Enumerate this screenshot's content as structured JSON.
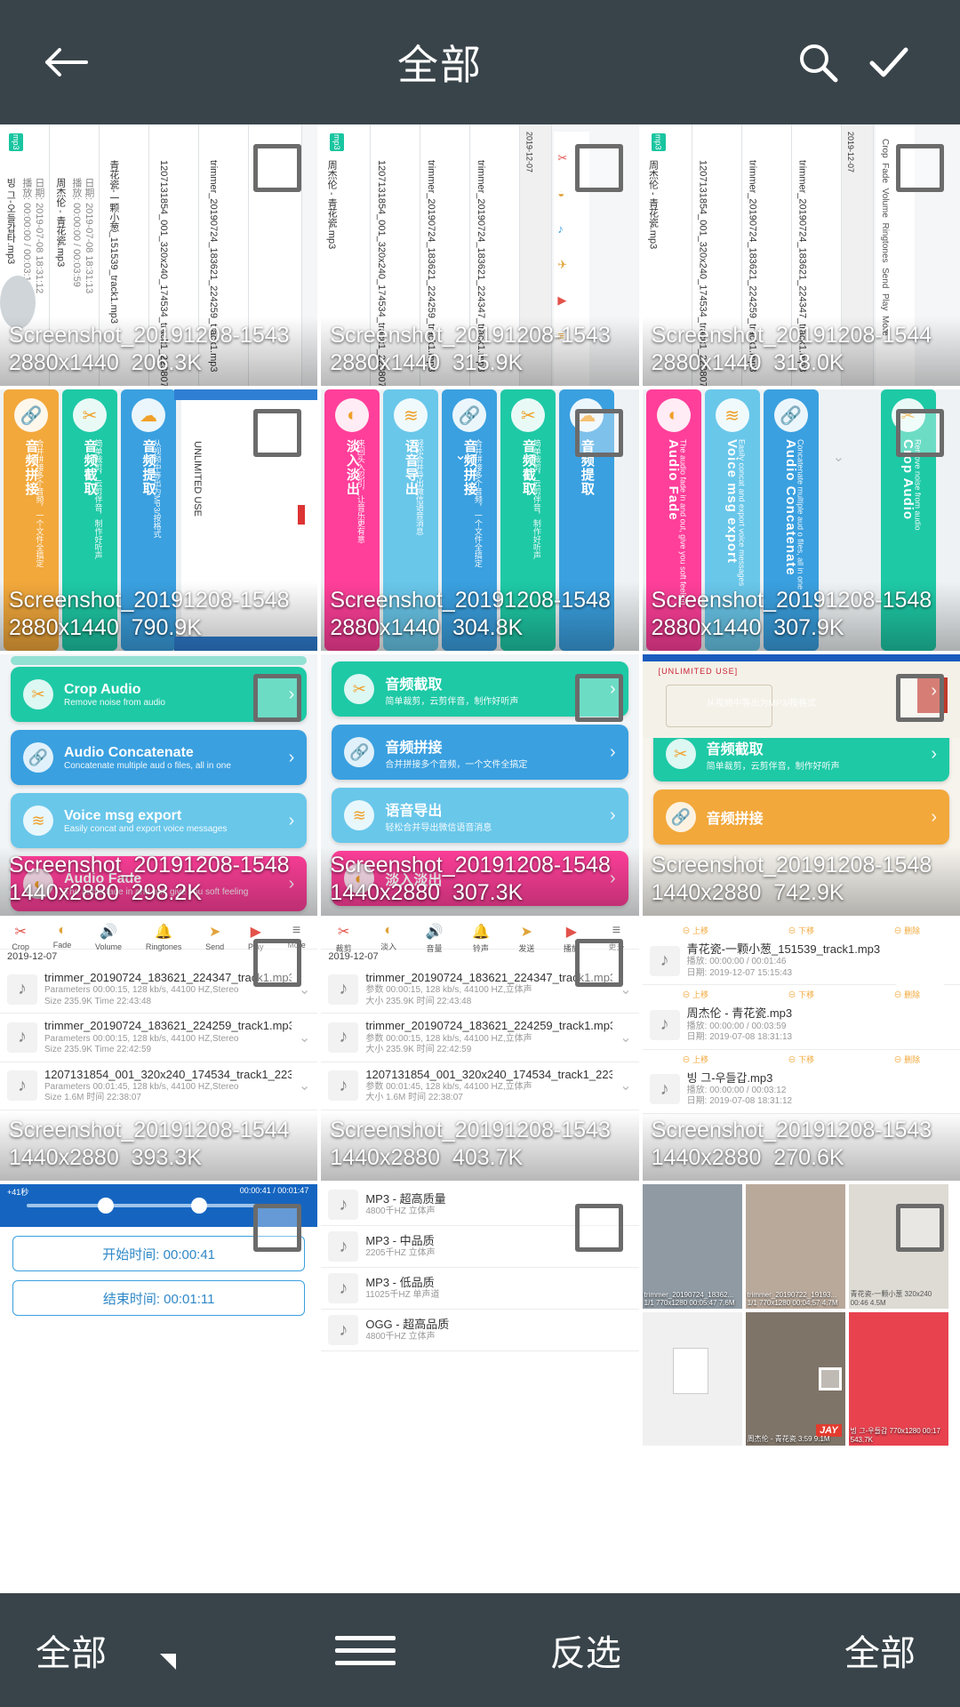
{
  "topbar": {
    "title": "全部",
    "back_icon": "arrow-left-icon",
    "search_icon": "search-icon",
    "confirm_icon": "check-icon"
  },
  "bottombar": {
    "left_label": "全部",
    "menu_icon": "hamburger-icon",
    "invert_label": "反选",
    "right_label": "全部",
    "dropdown_icon": "triangle-icon"
  },
  "colors": {
    "topbar_bg": "#39444a",
    "bottombar_bg": "#39444a",
    "accent_teal": "#1ec9a6",
    "accent_blue": "#3aa0e0",
    "accent_pink": "#ff3f9a",
    "accent_orange": "#f0a02a"
  },
  "items": [
    {
      "name": "Screenshot_20191208-1543",
      "dim": "2880x1440",
      "size": "206.3K",
      "type": "audio-list-vertical"
    },
    {
      "name": "Screenshot_20191208-1543",
      "dim": "2880x1440",
      "size": "315.9K",
      "type": "audio-list-vertical-tools"
    },
    {
      "name": "Screenshot_20191208-1544",
      "dim": "2880x1440",
      "size": "318.0K",
      "type": "audio-list-vertical-tools2"
    },
    {
      "name": "Screenshot_20191208-1548",
      "dim": "2880x1440",
      "size": "790.9K",
      "type": "banners-cn"
    },
    {
      "name": "Screenshot_20191208-1548",
      "dim": "2880x1440",
      "size": "304.8K",
      "type": "banners-cn2"
    },
    {
      "name": "Screenshot_20191208-1548",
      "dim": "2880x1440",
      "size": "307.9K",
      "type": "banners-en"
    },
    {
      "name": "Screenshot_20191208-1548",
      "dim": "1440x2880",
      "size": "298.2K",
      "type": "cards-en"
    },
    {
      "name": "Screenshot_20191208-1548",
      "dim": "1440x2880",
      "size": "307.3K",
      "type": "cards-cn"
    },
    {
      "name": "Screenshot_20191208-1548",
      "dim": "1440x2880",
      "size": "742.9K",
      "type": "cards-cn2"
    },
    {
      "name": "Screenshot_20191208-1544",
      "dim": "1440x2880",
      "size": "393.3K",
      "type": "filelist-1"
    },
    {
      "name": "Screenshot_20191208-1543",
      "dim": "1440x2880",
      "size": "403.7K",
      "type": "filelist-2"
    },
    {
      "name": "Screenshot_20191208-1543",
      "dim": "1440x2880",
      "size": "270.6K",
      "type": "filelist-3"
    },
    {
      "name": "",
      "dim": "",
      "size": "",
      "type": "trim-times"
    },
    {
      "name": "",
      "dim": "",
      "size": "",
      "type": "quality-list"
    },
    {
      "name": "",
      "dim": "",
      "size": "",
      "type": "gallery"
    }
  ],
  "thumb_content": {
    "vertical_tracks": [
      {
        "tag": "mp3",
        "title": "빙 그-오들갑타.mp3",
        "sub1": "播放: 00:00:00 / 00:03:12",
        "sub2": "日期: 2019-07-08 18:31:12"
      },
      {
        "tag": "mp3",
        "title": "周杰伦 - 青花瓷.mp3",
        "sub1": "播放: 00:00:00 / 00:03:59",
        "sub2": "日期: 2019-07-08 18:31:13"
      },
      {
        "tag": "mp3",
        "title": "青花瓷-一颗小葱_151539_track1.mp3",
        "sub1": "播放: 00:00:00 / 00:01:46",
        "sub2": "日期: 2019-12-07 15:15:43"
      },
      {
        "tag": "mp3",
        "title": "1207131854_001_320x240_174534_track1_223807.mp3",
        "sub1": "Parameters 00:01:45, 128 kb/s, 44100 HZ,立体声",
        "sub2": "Size 1.6M 时间 22:38:07"
      },
      {
        "tag": "mp3",
        "title": "trimmer_20190724_183621_224259_track1.mp3",
        "sub1": "Parameters 00:00:15, 128 kb/s, 44100 HZ,Stereo",
        "sub2": "Size 235.9K Time 22:42:59"
      },
      {
        "tag": "mp3",
        "title": "trimmer_20190724_183621_224347_track1.mp3",
        "sub1": "Parameters 00:00:15, 128 kb/s, 44100 HZ,Stereo",
        "sub2": "Size 235.9K Time 22:43:48"
      }
    ],
    "banner_cn": [
      {
        "title": "音频拼接",
        "sub": "合并拼接多个音频，一个文件全搞定",
        "color": "#f2a83b"
      },
      {
        "title": "音频截取",
        "sub": "简单裁剪，云剪伴音，制作好听声",
        "color": "#1ec9a6"
      },
      {
        "title": "音频提取",
        "sub": "从视频中等出为MP3/按格式",
        "color": "#3aa0e0"
      },
      {
        "title": "淡入淡出",
        "sub": "来回头入忍引，让音乐更有意",
        "color": "#ff3f9a"
      },
      {
        "title": "语音导出",
        "sub": "轻松合并导出微信语音消息",
        "color": "#69c7ea"
      },
      {
        "title": "音频拼接",
        "sub": "合并拼接多个音频，一个文件全搞定",
        "color": "#3aa0e0"
      }
    ],
    "banner_en": [
      {
        "title": "Audio Fade",
        "sub": "The audio fade in and out, give you soft feeling",
        "color": "#ff3f9a"
      },
      {
        "title": "Voice msg export",
        "sub": "Easily concat and export voice messages",
        "color": "#69c7ea"
      },
      {
        "title": "Audio Concatenate",
        "sub": "Concatenate multiple aud o files, all in one",
        "color": "#3aa0e0"
      },
      {
        "title": "Crop Audio",
        "sub": "Remove noise from audio",
        "color": "#1ec9a6"
      }
    ],
    "cards_en": [
      {
        "title": "Crop Audio",
        "sub": "Remove noise from audio",
        "color": "#1ec9a6",
        "icon": "scissors-icon"
      },
      {
        "title": "Audio Concatenate",
        "sub": "Concatenate multiple aud o files, all in one",
        "color": "#3aa0e0",
        "icon": "link-icon"
      },
      {
        "title": "Voice msg export",
        "sub": "Easily concat and export voice messages",
        "color": "#69c7ea",
        "icon": "wave-icon"
      },
      {
        "title": "Audio Fade",
        "sub": "The audio fade in and out, give you soft feeling",
        "color": "#ff3f9a",
        "icon": "fade-icon"
      }
    ],
    "cards_cn": [
      {
        "title": "音频截取",
        "sub": "简单裁剪，云剪伴音，制作好听声",
        "color": "#1ec9a6",
        "icon": "scissors-icon"
      },
      {
        "title": "音频拼接",
        "sub": "合并拼接多个音频，一个文件全搞定",
        "color": "#3aa0e0",
        "icon": "link-icon"
      },
      {
        "title": "语音导出",
        "sub": "轻松合并导出微信语音消息",
        "color": "#69c7ea",
        "icon": "wave-icon"
      },
      {
        "title": "淡入淡出",
        "sub": "来回淡入淡出，让音乐更有感",
        "color": "#ff3f9a",
        "icon": "fade-icon"
      }
    ],
    "cards_cn2": [
      {
        "title": "音频提取",
        "sub": "从视频中等出为MP3/按格式",
        "color": "#3aa0e0",
        "icon": "extract-icon"
      },
      {
        "title": "音频截取",
        "sub": "简单裁剪，云剪伴音，制作好听声",
        "color": "#1ec9a6",
        "icon": "scissors-icon"
      },
      {
        "title": "音频拼接",
        "sub": "合并拼接多个音频",
        "color": "#f2a83b",
        "icon": "link-icon"
      }
    ],
    "toolbar_en": [
      "Crop",
      "Fade",
      "Volume",
      "Ringtones",
      "Send",
      "Play",
      "More"
    ],
    "toolbar_cn": [
      "裁剪",
      "淡入",
      "音量",
      "铃声",
      "发送",
      "播放",
      "更多"
    ],
    "date_header": "2019-12-07",
    "file_rows": [
      {
        "title": "trimmer_20190724_183621_224347_track1.mp3",
        "p1": "Parameters 00:00:15, 128 kb/s, 44100 HZ,Stereo",
        "p2": "Size 235.9K  Time 22:43:48"
      },
      {
        "title": "trimmer_20190724_183621_224259_track1.mp3",
        "p1": "Parameters 00:00:15, 128 kb/s, 44100 HZ,Stereo",
        "p2": "Size 235.9K  Time 22:42:59"
      },
      {
        "title": "1207131854_001_320x240_174534_track1_223807.mp3",
        "p1": "Parameters 00:01:45, 128 kb/s, 44100 HZ,Stereo",
        "p2": "Size 1.6M  时间 22:38:07"
      }
    ],
    "file_rows_cn": [
      {
        "title": "trimmer_20190724_183621_224347_track1.mp3",
        "p1": "参数 00:00:15, 128 kb/s, 44100 HZ,立体声",
        "p2": "大小 235.9K  时间 22:43:48"
      },
      {
        "title": "trimmer_20190724_183621_224259_track1.mp3",
        "p1": "参数 00:00:15, 128 kb/s, 44100 HZ,立体声",
        "p2": "大小 235.9K  时间 22:42:59"
      },
      {
        "title": "1207131854_001_320x240_174534_track1_223807.mp3",
        "p1": "参数 00:01:45, 128 kb/s, 44100 HZ,立体声",
        "p2": "大小 1.6M  时间 22:38:07"
      }
    ],
    "action_row": [
      "上移",
      "下移",
      "删除"
    ],
    "play_rows": [
      {
        "title": "青花瓷-一颗小葱_151539_track1.mp3",
        "p1": "播放: 00:00:00 / 00:01:46",
        "p2": "日期: 2019-12-07 15:15:43"
      },
      {
        "title": "周杰伦 - 青花瓷.mp3",
        "p1": "播放: 00:00:00 / 00:03:59",
        "p2": "日期: 2019-07-08 18:31:13"
      },
      {
        "title": "빙 그-우들갑.mp3",
        "p1": "播放: 00:00:00 / 00:03:12",
        "p2": "日期: 2019-07-08 18:31:12"
      }
    ],
    "trim": {
      "start_label": "开始时间: 00:00:41",
      "end_label": "结束时间: 00:01:11",
      "time_left": "+41秒",
      "time_right": "00:00:41 / 00:01:47"
    },
    "quality_rows": [
      {
        "title": "MP3 - 超高质量",
        "sub": "4800千HZ 立体声"
      },
      {
        "title": "MP3 - 中品质",
        "sub": "2205千HZ 立体声"
      },
      {
        "title": "MP3 - 低品质",
        "sub": "11025千HZ 单声道"
      },
      {
        "title": "OGG - 超高品质",
        "sub": "4800千HZ 立体声"
      }
    ],
    "gallery_labels": [
      "trimmer_20190724_18362...\n1/1 770x1280 00:05:47 7.6M",
      "trimmer_20190722_19193...\n1/1 770x1280 00:04:57 4.7M",
      "青花瓷-一颗小葱\n320x240 00:46 4.5M",
      "周杰伦 - 青花瓷\n3:59 9.1M",
      "빙 그-우들갑\n770x1280 00:17 543.7K"
    ]
  }
}
